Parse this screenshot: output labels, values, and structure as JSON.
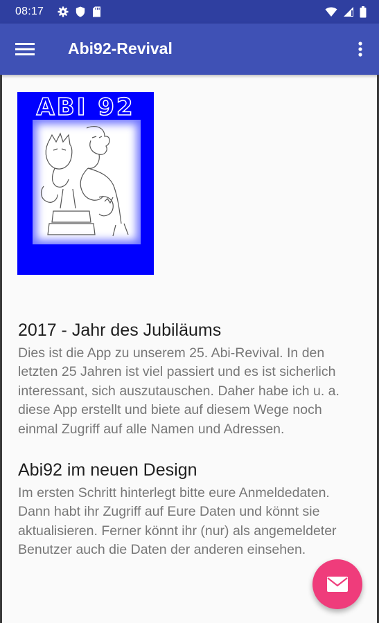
{
  "status_bar": {
    "time": "08:17",
    "left_icons": [
      "gear-icon",
      "shield-icon",
      "sd-card-icon"
    ],
    "right_icons": [
      "wifi-icon",
      "signal-icon",
      "battery-icon"
    ],
    "color": "#2f3fa0"
  },
  "app_bar": {
    "title": "Abi92-Revival",
    "color": "#3f51b5"
  },
  "logo": {
    "text": "ABI 92",
    "background": "#0000ff"
  },
  "sections": [
    {
      "title": "2017 - Jahr des Jubiläums",
      "body": "Dies ist die App zu unserem 25. Abi-Revival. In den letzten 25 Jahren ist viel passiert und es ist sicherlich interessant, sich auszutauschen. Daher habe ich u. a. diese App erstellt und biete auf diesem Wege noch einmal Zugriff auf alle Namen und Adressen."
    },
    {
      "title": "Abi92 im neuen Design",
      "body": "Im ersten Schritt hinterlegt bitte eure Anmeldedaten. Dann habt ihr Zugriff auf Eure Daten und könnt sie aktualisieren. Ferner könnt ihr (nur) als angemeldeter Benutzer auch die Daten der anderen einsehen."
    }
  ],
  "fab": {
    "icon": "mail-icon",
    "color": "#ef3c7b"
  }
}
